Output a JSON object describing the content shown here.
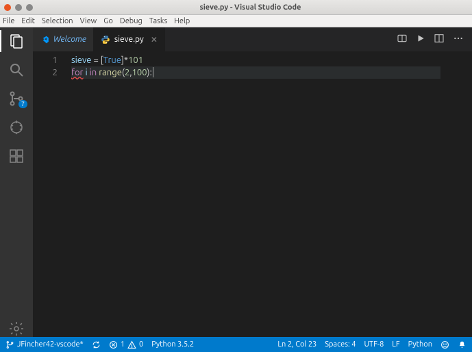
{
  "window": {
    "title": "sieve.py - Visual Studio Code"
  },
  "menubar": [
    "File",
    "Edit",
    "Selection",
    "View",
    "Go",
    "Debug",
    "Tasks",
    "Help"
  ],
  "activitybar": {
    "scm_badge": "7"
  },
  "tabs": {
    "welcome": "Welcome",
    "active": "sieve.py"
  },
  "gutter": {
    "l1": "1",
    "l2": "2"
  },
  "code": {
    "l1": {
      "v1": "sieve",
      "eq": " = ",
      "lb": "[",
      "c1": "True",
      "rb": "]",
      "mul": "*",
      "n1": "101"
    },
    "l2": {
      "kfor": "for",
      "sp1": " ",
      "v1": "i",
      "sp2": " ",
      "kin": "in",
      "sp3": " ",
      "fn": "range",
      "lp": "(",
      "n1": "2",
      "cm": ",",
      "n2": "100",
      "rp": ")",
      "col": ":"
    }
  },
  "chart_data": {
    "type": "table",
    "title": "File contents: sieve.py",
    "lines": [
      "sieve = [True]*101",
      "for i in range(2,100):"
    ]
  },
  "statusbar": {
    "branch": "JFincher42-vscode*",
    "errors": "1",
    "warnings": "0",
    "interpreter": "Python 3.5.2",
    "cursor": "Ln 2, Col 23",
    "spaces": "Spaces: 4",
    "encoding": "UTF-8",
    "eol": "LF",
    "language": "Python"
  }
}
